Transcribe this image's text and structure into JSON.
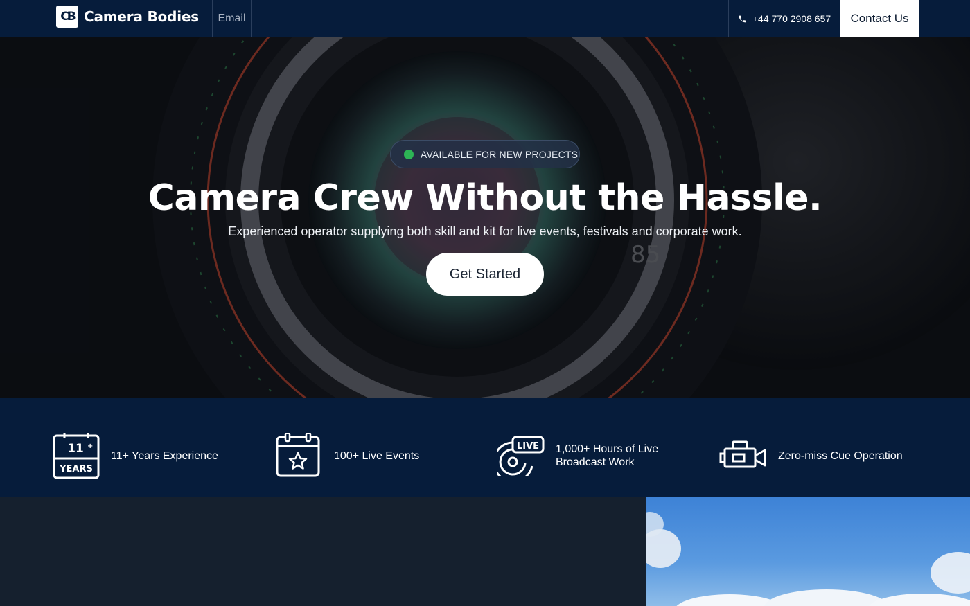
{
  "nav": {
    "logo_mark": "CB",
    "brand": "Camera Bodies",
    "email_label": "Email",
    "phone": "+44 770 2908 657",
    "contact_label": "Contact Us"
  },
  "hero": {
    "badge": "AVAILABLE FOR NEW PROJECTS",
    "title": "Camera Crew Without the Hassle.",
    "subtitle": "Experienced operator supplying both skill and kit for live events, festivals and corporate work.",
    "cta": "Get Started"
  },
  "stats": [
    {
      "icon": "calendar-years-icon",
      "icon_number": "11",
      "icon_label": "YEARS",
      "text": "11+ Years Experience"
    },
    {
      "icon": "calendar-star-icon",
      "text": "100+ Live Events"
    },
    {
      "icon": "live-broadcast-icon",
      "icon_label": "LIVE",
      "text": "1,000+ Hours of Live Broadcast Work"
    },
    {
      "icon": "video-camera-icon",
      "text": "Zero-miss Cue Operation"
    }
  ],
  "colors": {
    "navy": "#061c3b",
    "dark": "#15202e",
    "badge_dot": "#2db555"
  }
}
